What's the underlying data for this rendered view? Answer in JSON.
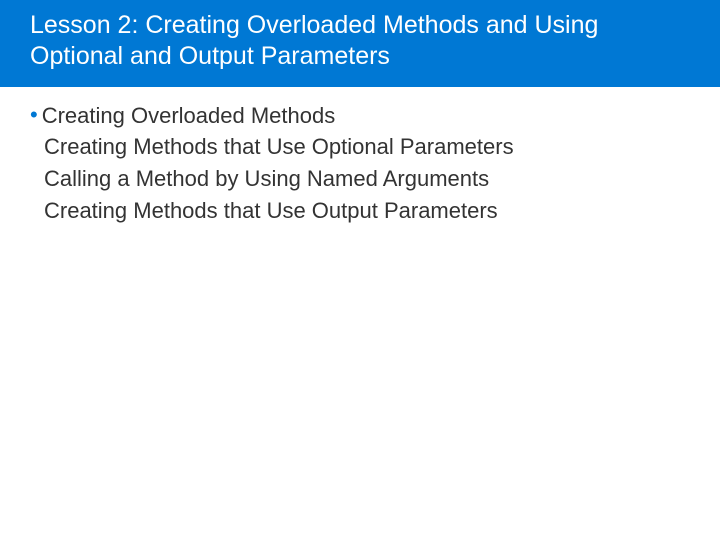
{
  "header": {
    "title": "Lesson 2: Creating Overloaded Methods and Using Optional and Output Parameters"
  },
  "bullets": {
    "marker": "•",
    "item0": "Creating Overloaded Methods",
    "item1": "Creating Methods that Use Optional Parameters",
    "item2": "Calling a Method by Using Named Arguments",
    "item3": "Creating Methods that Use Output Parameters"
  }
}
